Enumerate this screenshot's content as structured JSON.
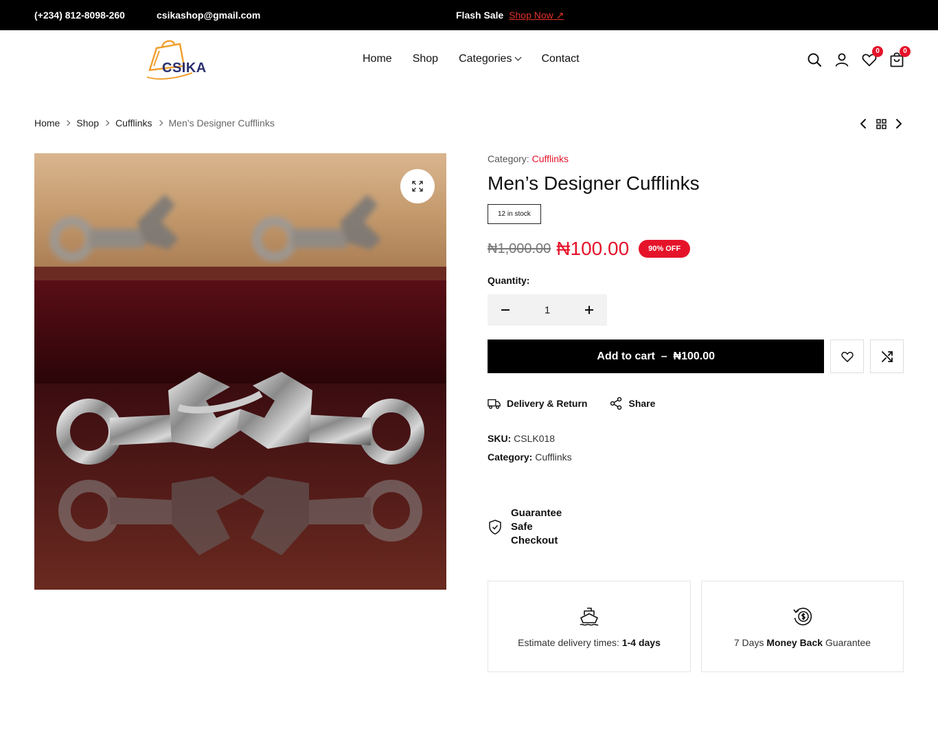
{
  "topbar": {
    "phone": "(+234) 812-8098-260",
    "email": "csikashop@gmail.com",
    "flash_label": "Flash Sale",
    "shop_now": "Shop Now ↗"
  },
  "header": {
    "logo_text": "CSIKA",
    "nav": [
      "Home",
      "Shop",
      "Categories",
      "Contact"
    ],
    "wishlist_count": "0",
    "cart_count": "0"
  },
  "breadcrumb": [
    "Home",
    "Shop",
    "Cufflinks",
    "Men’s Designer Cufflinks"
  ],
  "product": {
    "category_label": "Category:",
    "category": "Cufflinks",
    "title": "Men’s Designer Cufflinks",
    "stock": "12 in stock",
    "old_price": "₦1,000.00",
    "price": "₦100.00",
    "discount": "90% OFF",
    "quantity_label": "Quantity:",
    "quantity": "1",
    "add_to_cart": "Add to cart  –  ₦100.00",
    "delivery_return": "Delivery & Return",
    "share": "Share",
    "sku_label": "SKU:",
    "sku": "CSLK018",
    "meta_category_label": "Category:",
    "meta_category": "Cufflinks",
    "guarantee": "Guarantee Safe Checkout"
  },
  "info_boxes": {
    "delivery_prefix": "Estimate delivery times:",
    "delivery_bold": "1-4 days",
    "money_prefix": "7 Days",
    "money_bold": "Money Back",
    "money_suffix": "Guarantee"
  },
  "colors": {
    "accent": "#e5132a",
    "black": "#000000",
    "logo_orange": "#f0a030",
    "logo_navy": "#2a2f6e"
  },
  "icons": [
    "search-icon",
    "user-icon",
    "heart-icon",
    "bag-icon",
    "zoom-icon",
    "compare-icon",
    "truck-icon",
    "share-icon",
    "shield-icon",
    "ship-icon",
    "money-back-icon"
  ]
}
